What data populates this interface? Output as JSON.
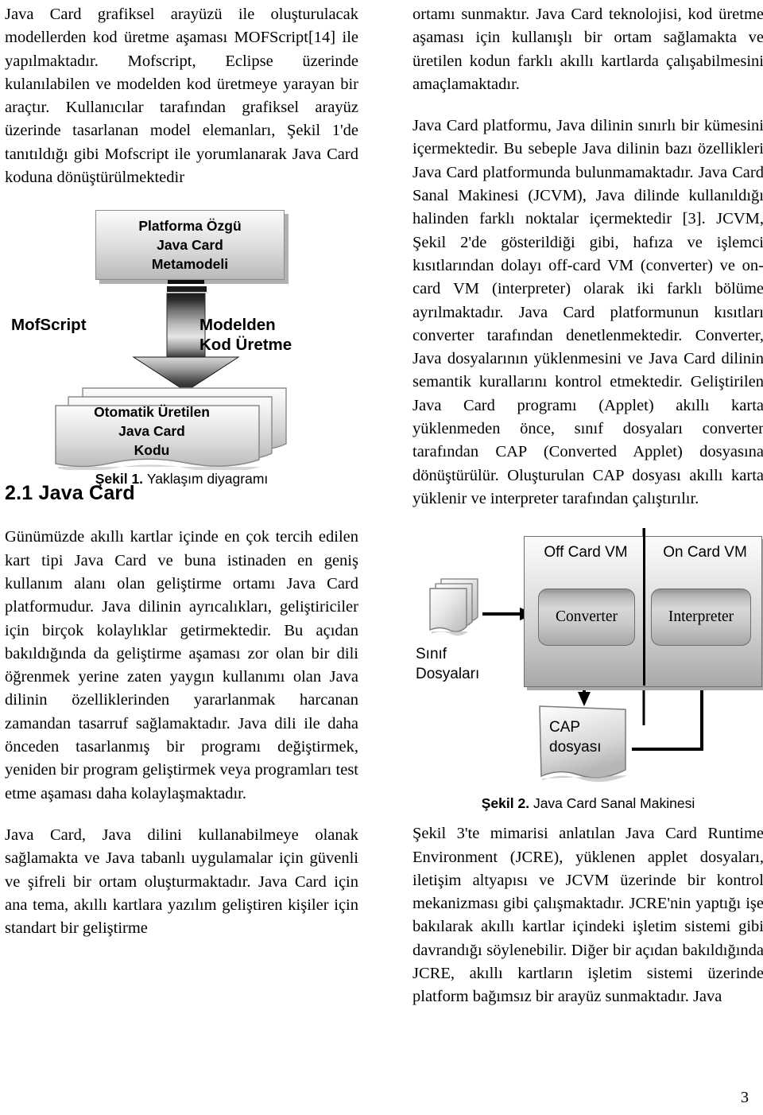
{
  "page": {
    "number": "3"
  },
  "left_column": {
    "paragraph_1": "Java Card grafiksel arayüzü ile oluşturulacak modellerden kod üretme aşaması MOFScript[14] ile yapılmaktadır. Mofscript, Eclipse üzerinde kulanılabilen ve modelden kod üretmeye yarayan bir araçtır. Kullanıcılar tarafından grafiksel arayüz üzerinde tasarlanan model elemanları, Şekil 1'de tanıtıldığı gibi Mofscript ile yorumlanarak Java Card koduna dönüştürülmektedir",
    "figure1": {
      "metamodel_box": {
        "line1": "Platforma Özgü",
        "line2": "Java Card",
        "line3": "Metamodeli"
      },
      "arrow_label_left": "MofScript",
      "arrow_label_right_line1": "Modelden",
      "arrow_label_right_line2": "Kod Üretme",
      "doc_stack": {
        "line1": "Otomatik Üretilen",
        "line2": "Java Card",
        "line3": "Kodu"
      },
      "caption_label": "Şekil 1.",
      "caption_text": "Yaklaşım diyagramı"
    },
    "section_heading": "2.1 Java Card",
    "paragraph_2": "Günümüzde akıllı kartlar içinde en çok tercih edilen kart tipi Java Card ve buna istinaden en geniş kullanım alanı olan geliştirme ortamı Java Card platformudur.  Java dilinin ayrıcalıkları, geliştiriciler için birçok kolaylıklar getirmektedir. Bu açıdan bakıldığında da geliştirme aşaması zor olan bir dili öğrenmek yerine zaten yaygın kullanımı olan Java dilinin özelliklerinden yararlanmak harcanan zamandan tasarruf sağlamaktadır. Java dili ile daha önceden tasarlanmış bir programı değiştirmek, yeniden bir program geliştirmek veya programları test etme aşaması daha kolaylaşmaktadır.",
    "paragraph_3": "Java Card, Java dilini kullanabilmeye olanak sağlamakta ve Java tabanlı uygulamalar için güvenli ve şifreli bir ortam oluşturmaktadır. Java Card için ana tema, akıllı kartlara yazılım geliştiren kişiler için standart bir geliştirme"
  },
  "right_column": {
    "paragraph_1": "ortamı sunmaktır. Java Card teknolojisi, kod üretme aşaması için kullanışlı bir ortam sağlamakta ve üretilen kodun farklı akıllı kartlarda çalışabilmesini amaçlamaktadır.",
    "paragraph_2": "Java Card platformu, Java dilinin sınırlı bir kümesini içermektedir. Bu sebeple Java dilinin bazı özellikleri Java Card platformunda bulunmamaktadır. Java Card Sanal Makinesi (JCVM), Java dilinde kullanıldığı halinden farklı noktalar içermektedir [3]. JCVM, Şekil 2'de gösterildiği gibi, hafıza ve işlemci kısıtlarından dolayı off-card VM (converter) ve on-card VM (interpreter) olarak iki farklı bölüme ayrılmaktadır. Java Card platformunun kısıtları converter tarafından denetlenmektedir. Converter, Java dosyalarının yüklenmesini ve Java Card dilinin semantik kurallarını kontrol etmektedir. Geliştirilen Java Card programı (Applet) akıllı karta yüklenmeden önce, sınıf dosyaları converter tarafından CAP (Converted Applet) dosyasına dönüştürülür. Oluşturulan CAP dosyası akıllı karta yüklenir ve interpreter tarafından çalıştırılır.",
    "figure2": {
      "off_card_vm_label": "Off Card VM",
      "on_card_vm_label": "On Card VM",
      "converter_label": "Converter",
      "interpreter_label": "Interpreter",
      "class_files_line1": "Sınıf",
      "class_files_line2": "Dosyaları",
      "cap_file_line1": "CAP",
      "cap_file_line2": "dosyası",
      "caption_label": "Şekil 2.",
      "caption_text": "Java Card Sanal Makinesi"
    },
    "paragraph_3": "Şekil 3'te mimarisi anlatılan Java Card Runtime Environment (JCRE), yüklenen applet dosyaları, iletişim altyapısı ve JCVM üzerinde bir kontrol mekanizması gibi çalışmaktadır. JCRE'nin yaptığı işe bakılarak akıllı kartlar içindeki işletim sistemi gibi davrandığı söylenebilir. Diğer bir açıdan bakıldığında JCRE, akıllı kartların işletim sistemi üzerinde platform bağımsız bir arayüz sunmaktadır. Java"
  },
  "colors": {
    "text": "#000000",
    "shape_fill_light": "#fbfbfb",
    "shape_fill_dark": "#a8a8a8",
    "shape_border": "#6e6e6e",
    "shadow": "#b0b0b0",
    "line": "#000000"
  }
}
